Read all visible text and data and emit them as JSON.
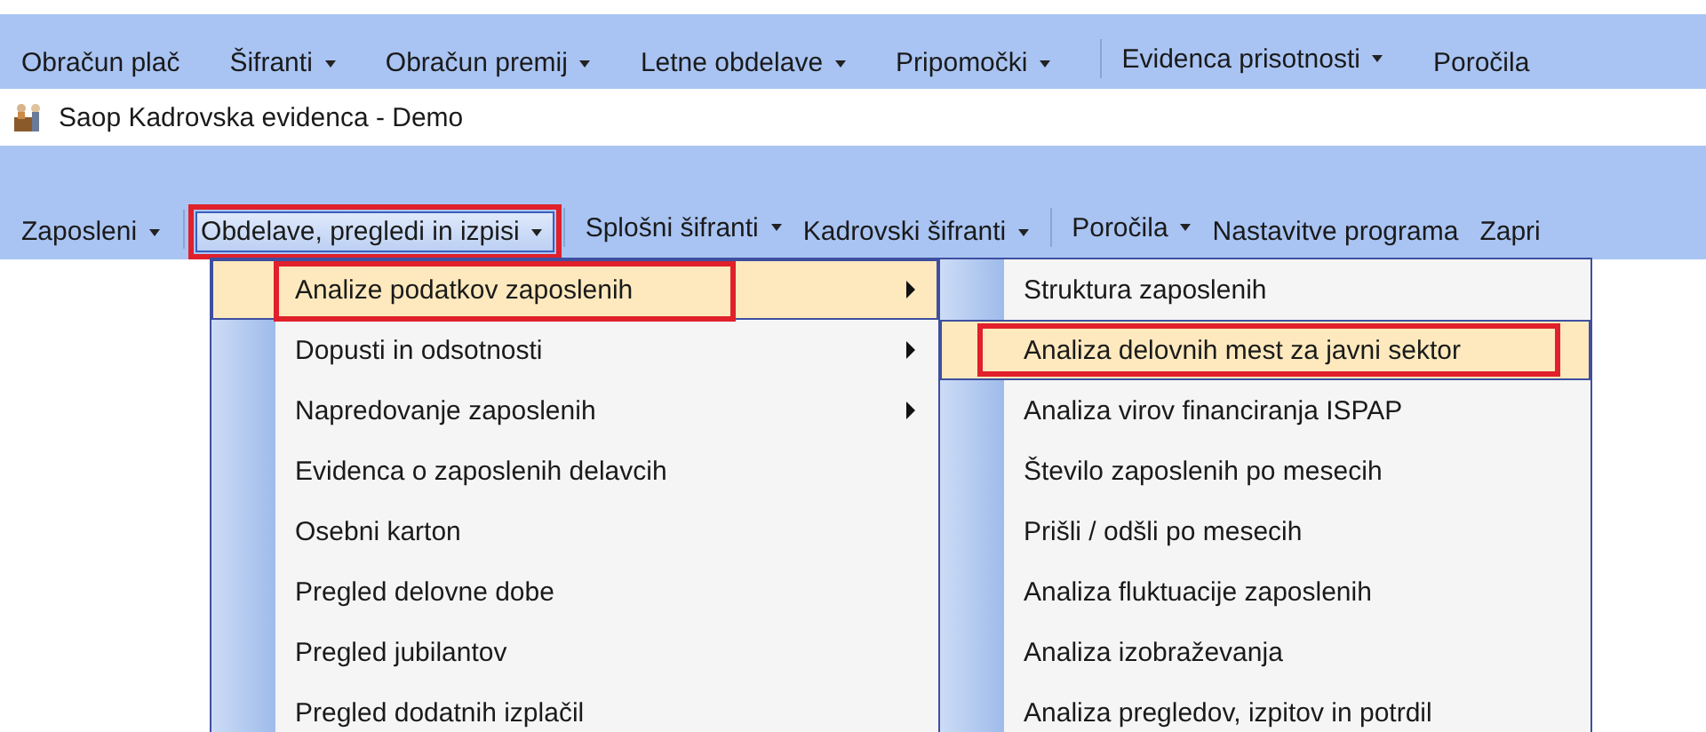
{
  "main_menu": [
    {
      "label": "Obračun plač",
      "has_dropdown": false,
      "separator_before": false
    },
    {
      "label": "Šifranti",
      "has_dropdown": true,
      "separator_before": false
    },
    {
      "label": "Obračun premij",
      "has_dropdown": true,
      "separator_before": false
    },
    {
      "label": "Letne obdelave",
      "has_dropdown": true,
      "separator_before": false
    },
    {
      "label": "Pripomočki",
      "has_dropdown": true,
      "separator_before": false
    },
    {
      "label": "Evidenca prisotnosti",
      "has_dropdown": true,
      "separator_before": true
    },
    {
      "label": "Poročila",
      "has_dropdown": false,
      "separator_before": false
    }
  ],
  "window": {
    "title": "Saop Kadrovska evidenca  - Demo"
  },
  "module_menu": [
    {
      "label": "Zaposleni",
      "has_dropdown": true,
      "separator_before": false,
      "selected": false,
      "highlighted": false
    },
    {
      "label": "Obdelave, pregledi in izpisi",
      "has_dropdown": true,
      "separator_before": true,
      "selected": true,
      "highlighted": true
    },
    {
      "label": "Splošni šifranti",
      "has_dropdown": true,
      "separator_before": true,
      "selected": false,
      "highlighted": false
    },
    {
      "label": "Kadrovski šifranti",
      "has_dropdown": true,
      "separator_before": false,
      "selected": false,
      "highlighted": false
    },
    {
      "label": "Poročila",
      "has_dropdown": true,
      "separator_before": true,
      "selected": false,
      "highlighted": false
    },
    {
      "label": "Nastavitve programa",
      "has_dropdown": false,
      "separator_before": false,
      "selected": false,
      "highlighted": false
    },
    {
      "label": "Zapri",
      "has_dropdown": false,
      "separator_before": false,
      "selected": false,
      "highlighted": false
    }
  ],
  "dropdown": [
    {
      "label": "Analize podatkov zaposlenih",
      "has_submenu": true,
      "selected": true,
      "highlighted": true
    },
    {
      "label": "Dopusti in odsotnosti",
      "has_submenu": true,
      "selected": false,
      "highlighted": false
    },
    {
      "label": "Napredovanje zaposlenih",
      "has_submenu": true,
      "selected": false,
      "highlighted": false
    },
    {
      "label": "Evidenca o zaposlenih delavcih",
      "has_submenu": false,
      "selected": false,
      "highlighted": false
    },
    {
      "label": "Osebni karton",
      "has_submenu": false,
      "selected": false,
      "highlighted": false
    },
    {
      "label": "Pregled delovne dobe",
      "has_submenu": false,
      "selected": false,
      "highlighted": false
    },
    {
      "label": "Pregled jubilantov",
      "has_submenu": false,
      "selected": false,
      "highlighted": false
    },
    {
      "label": "Pregled dodatnih izplačil",
      "has_submenu": false,
      "selected": false,
      "highlighted": false
    }
  ],
  "submenu": [
    {
      "label": "Struktura zaposlenih",
      "selected": false,
      "highlighted": false
    },
    {
      "label": "Analiza delovnih mest za javni sektor",
      "selected": true,
      "highlighted": true
    },
    {
      "label": "Analiza virov financiranja ISPAP",
      "selected": false,
      "highlighted": false
    },
    {
      "label": "Število zaposlenih po mesecih",
      "selected": false,
      "highlighted": false
    },
    {
      "label": "Prišli / odšli po mesecih",
      "selected": false,
      "highlighted": false
    },
    {
      "label": "Analiza fluktuacije zaposlenih",
      "selected": false,
      "highlighted": false
    },
    {
      "label": "Analiza izobraževanja",
      "selected": false,
      "highlighted": false
    },
    {
      "label": "Analiza pregledov, izpitov in potrdil",
      "selected": false,
      "highlighted": false
    }
  ]
}
